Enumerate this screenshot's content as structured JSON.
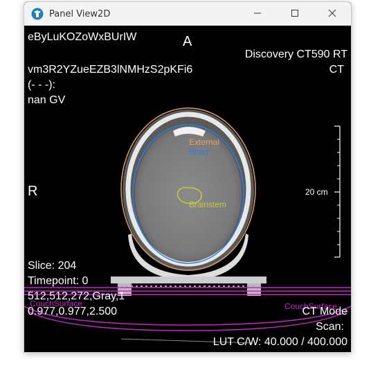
{
  "window": {
    "title": "Panel View2D",
    "icon": "app-logo-icon",
    "controls": [
      "minimize-icon",
      "maximize-icon",
      "close-icon"
    ]
  },
  "overlay": {
    "top_left": {
      "patient_name": "eByLuKOZoWxBUrIW",
      "patient_id": "vm3R2YZueEZB3lNMHzS2pKFi6",
      "misc": "(- - -):",
      "gv": "nan GV"
    },
    "top_right": {
      "scanner": "Discovery CT590 RT",
      "modality": "CT"
    },
    "orientation": {
      "top": "A",
      "left": "R"
    },
    "scale_bar": {
      "label": "20 cm"
    },
    "bottom_left": {
      "slice": "Slice: 204",
      "timepoint": "Timepoint: 0",
      "dims": "512,512,272,Gray,1",
      "spacing": "0.977,0.977,2.500"
    },
    "bottom_right": {
      "mode": "CT Mode",
      "scan": "Scan:",
      "lut": "LUT C/W: 40.000 / 400.000"
    }
  },
  "structures": [
    {
      "name": "External",
      "color": "#e8a060"
    },
    {
      "name": "Brain",
      "color": "#2d7fe0"
    },
    {
      "name": "Brainstem",
      "color": "#c8c83c"
    },
    {
      "name": "CouchSurface",
      "color": "#cc22cc"
    },
    {
      "name": "CouchSurface",
      "color": "#cc22cc"
    }
  ]
}
